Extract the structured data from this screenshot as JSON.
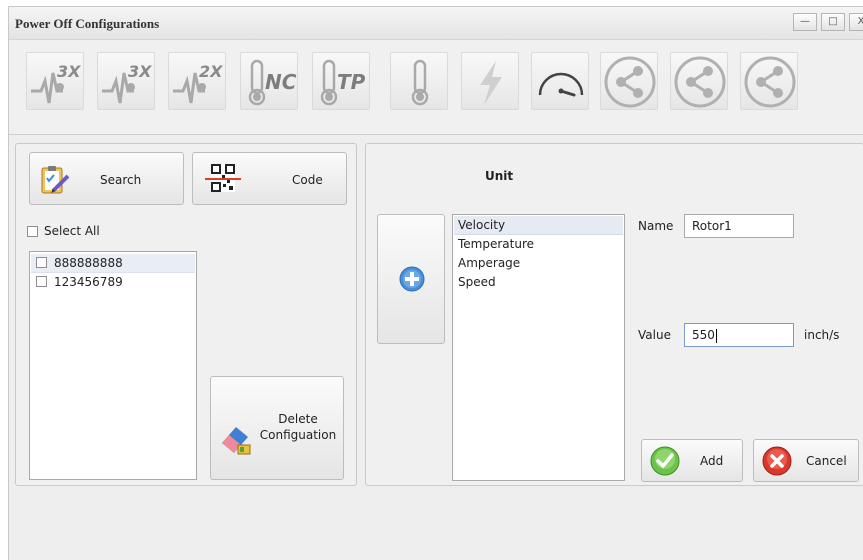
{
  "window": {
    "title": "Power Off Configurations",
    "controls": {
      "minimize": "—",
      "maximize": "□",
      "close": "X"
    }
  },
  "toolbar": {
    "items": [
      {
        "icon": "vibration-3x-icon",
        "label": "3X"
      },
      {
        "icon": "vibration-3x-icon",
        "label": "3X"
      },
      {
        "icon": "vibration-2x-icon",
        "label": "2X"
      },
      {
        "icon": "thermometer-nc-icon",
        "label": "NC"
      },
      {
        "icon": "thermometer-tp-icon",
        "label": "TP"
      },
      {
        "icon": "thermometer-icon",
        "label": ""
      },
      {
        "icon": "lightning-icon",
        "label": ""
      },
      {
        "icon": "speedometer-icon",
        "label": ""
      },
      {
        "icon": "share-icon",
        "label": ""
      },
      {
        "icon": "share-icon",
        "label": ""
      },
      {
        "icon": "share-icon",
        "label": ""
      }
    ]
  },
  "left": {
    "search_label": "Search",
    "code_label": "Code",
    "select_all_label": "Select All",
    "items": [
      "888888888",
      "123456789"
    ],
    "delete_label_line1": "Delete",
    "delete_label_line2": "Configuation"
  },
  "right": {
    "unit_heading": "Unit",
    "units": [
      "Velocity",
      "Temperature",
      "Amperage",
      "Speed"
    ],
    "selected_unit": "Velocity",
    "name_label": "Name",
    "name_value": "Rotor1",
    "value_label": "Value",
    "value_value": "550",
    "value_unit": "inch/s",
    "add_label": "Add",
    "cancel_label": "Cancel"
  },
  "colors": {
    "accent_blue": "#4a90d9",
    "add_green": "#6cc24a",
    "cancel_red": "#d9382c",
    "toolbar_icon_gray": "#a9a9a9"
  }
}
